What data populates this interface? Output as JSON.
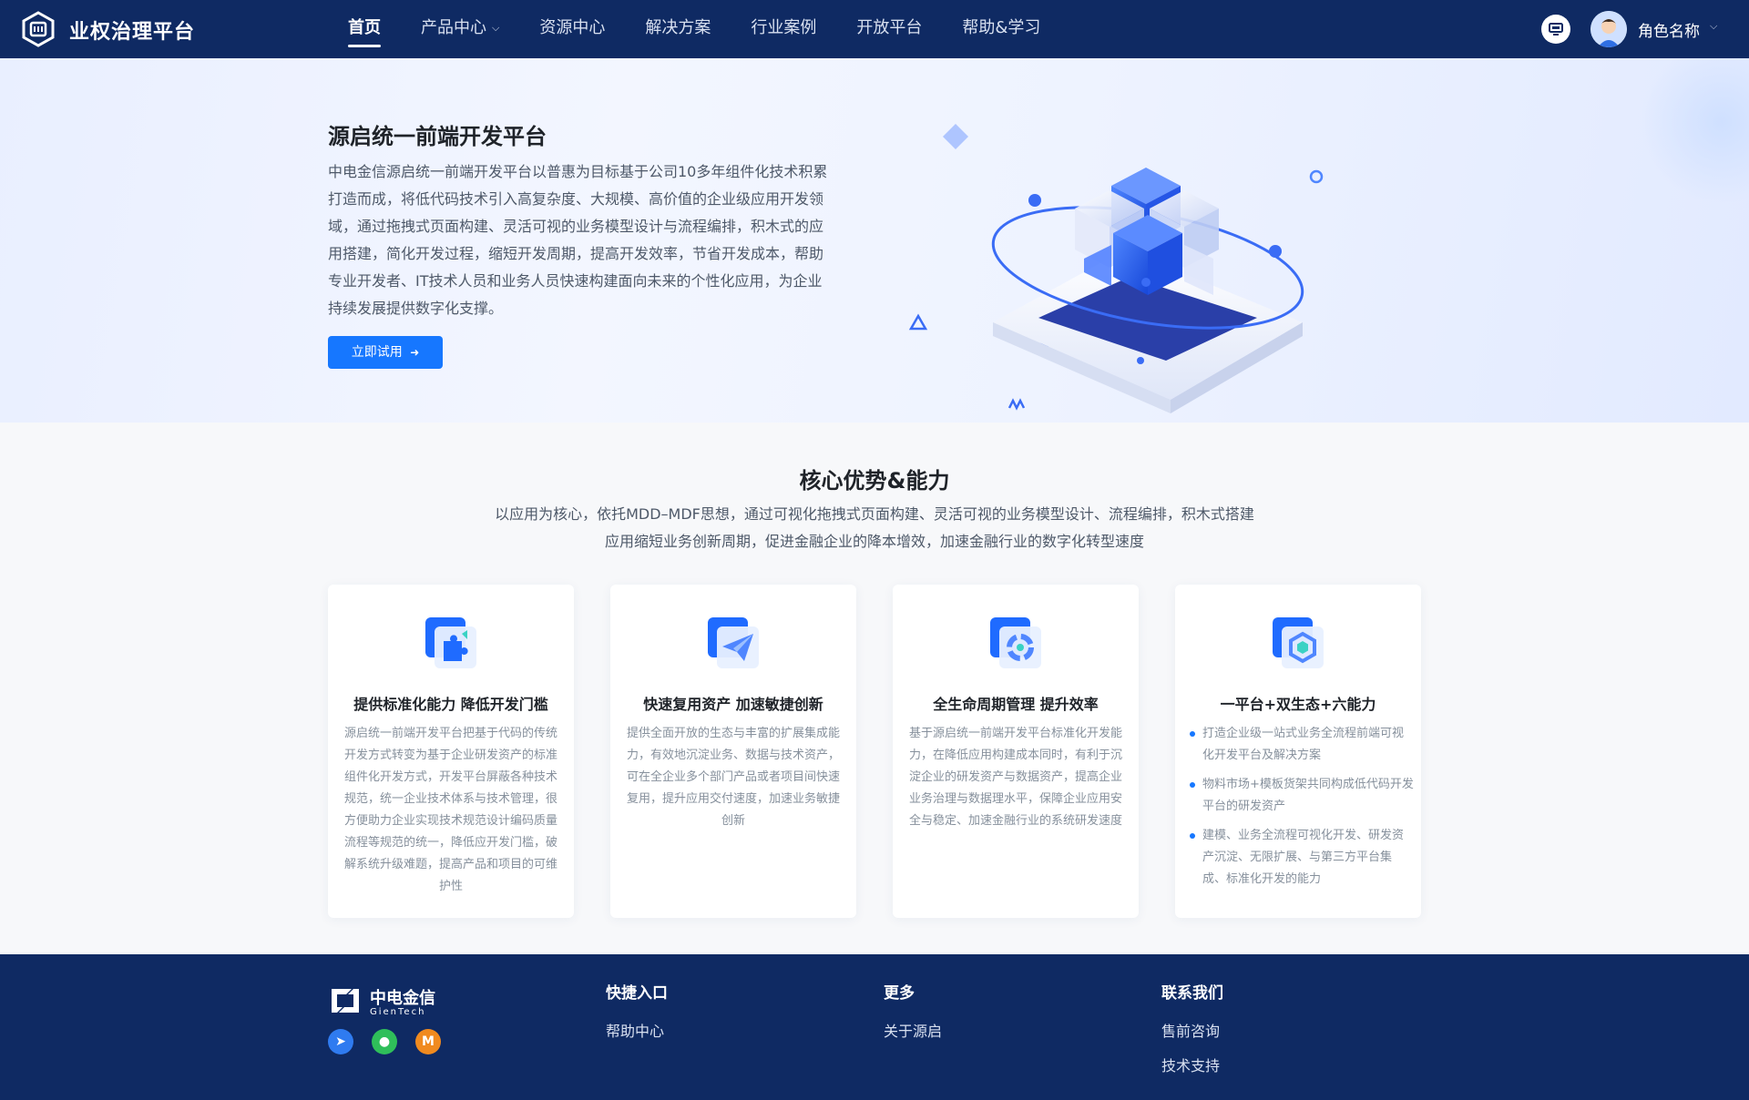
{
  "header": {
    "brand": "业权治理平台",
    "nav": [
      {
        "label": "首页",
        "active": true
      },
      {
        "label": "产品中心",
        "dropdown": true
      },
      {
        "label": "资源中心"
      },
      {
        "label": "解决方案"
      },
      {
        "label": "行业案例"
      },
      {
        "label": "开放平台"
      },
      {
        "label": "帮助&学习"
      }
    ],
    "user_name": "角色名称",
    "icons": [
      "logo-icon",
      "screen-icon",
      "avatar",
      "chevron-down-icon"
    ]
  },
  "hero": {
    "title": "源启统一前端开发平台",
    "description": "中电金信源启统一前端开发平台以普惠为目标基于公司10多年组件化技术积累打造而成，将低代码技术引入高复杂度、大规模、高价值的企业级应用开发领域，通过拖拽式页面构建、灵活可视的业务模型设计与流程编排，积木式的应用搭建，简化开发过程，缩短开发周期，提高开发效率，节省开发成本，帮助专业开发者、IT技术人员和业务人员快速构建面向未来的个性化应用，为企业持续发展提供数字化支撑。",
    "cta_label": "立即试用"
  },
  "advantages": {
    "title": "核心优势&能力",
    "description": "以应用为核心，依托MDD–MDF思想，通过可视化拖拽式页面构建、灵活可视的业务模型设计、流程编排，积木式搭建 应用缩短业务创新周期，促进金融企业的降本增效，加速金融行业的数字化转型速度",
    "cards": [
      {
        "icon": "puzzle-icon",
        "title": "提供标准化能力  降低开发门槛",
        "text": "源启统一前端开发平台把基于代码的传统开发方式转变为基于企业研发资产的标准组件化开发方式，开发平台屏蔽各种技术规范，统一企业技术体系与技术管理，很方便助力企业实现技术规范设计编码质量流程等规范的统一，降低应开发门槛，破解系统升级难题，提高产品和项目的可维护性"
      },
      {
        "icon": "paper-plane-icon",
        "title": "快速复用资产  加速敏捷创新",
        "text": "提供全面开放的生态与丰富的扩展集成能力，有效地沉淀业务、数据与技术资产，可在全企业多个部门产品或者项目间快速复用，提升应用交付速度，加速业务敏捷创新"
      },
      {
        "icon": "lifecycle-icon",
        "title": "全生命周期管理  提升效率",
        "text": "基于源启统一前端开发平台标准化开发能力，在降低应用构建成本同时，有利于沉淀企业的研发资产与数据资产，提高企业业务治理与数据理水平，保障企业应用安全与稳定、加速金融行业的系统研发速度"
      },
      {
        "icon": "hexagon-platform-icon",
        "title": "一平台+双生态+六能力",
        "list": [
          "打造企业级一站式业务全流程前端可视化开发平台及解决方案",
          "物料市场+模板货架共同构成低代码开发平台的研发资产",
          "建模、业务全流程可视化开发、研发资产沉淀、无限扩展、与第三方平台集成、标准化开发的能力"
        ]
      }
    ]
  },
  "footer": {
    "logo_text": "中电金信",
    "logo_sub": "GienTech",
    "social_icons": [
      "send-icon",
      "wechat-icon",
      "m-icon"
    ],
    "columns": [
      {
        "title": "快捷入口",
        "links": [
          "帮助中心"
        ]
      },
      {
        "title": "更多",
        "links": [
          "关于源启"
        ]
      },
      {
        "title": "联系我们",
        "links": [
          "售前咨询",
          "技术支持"
        ]
      }
    ]
  }
}
